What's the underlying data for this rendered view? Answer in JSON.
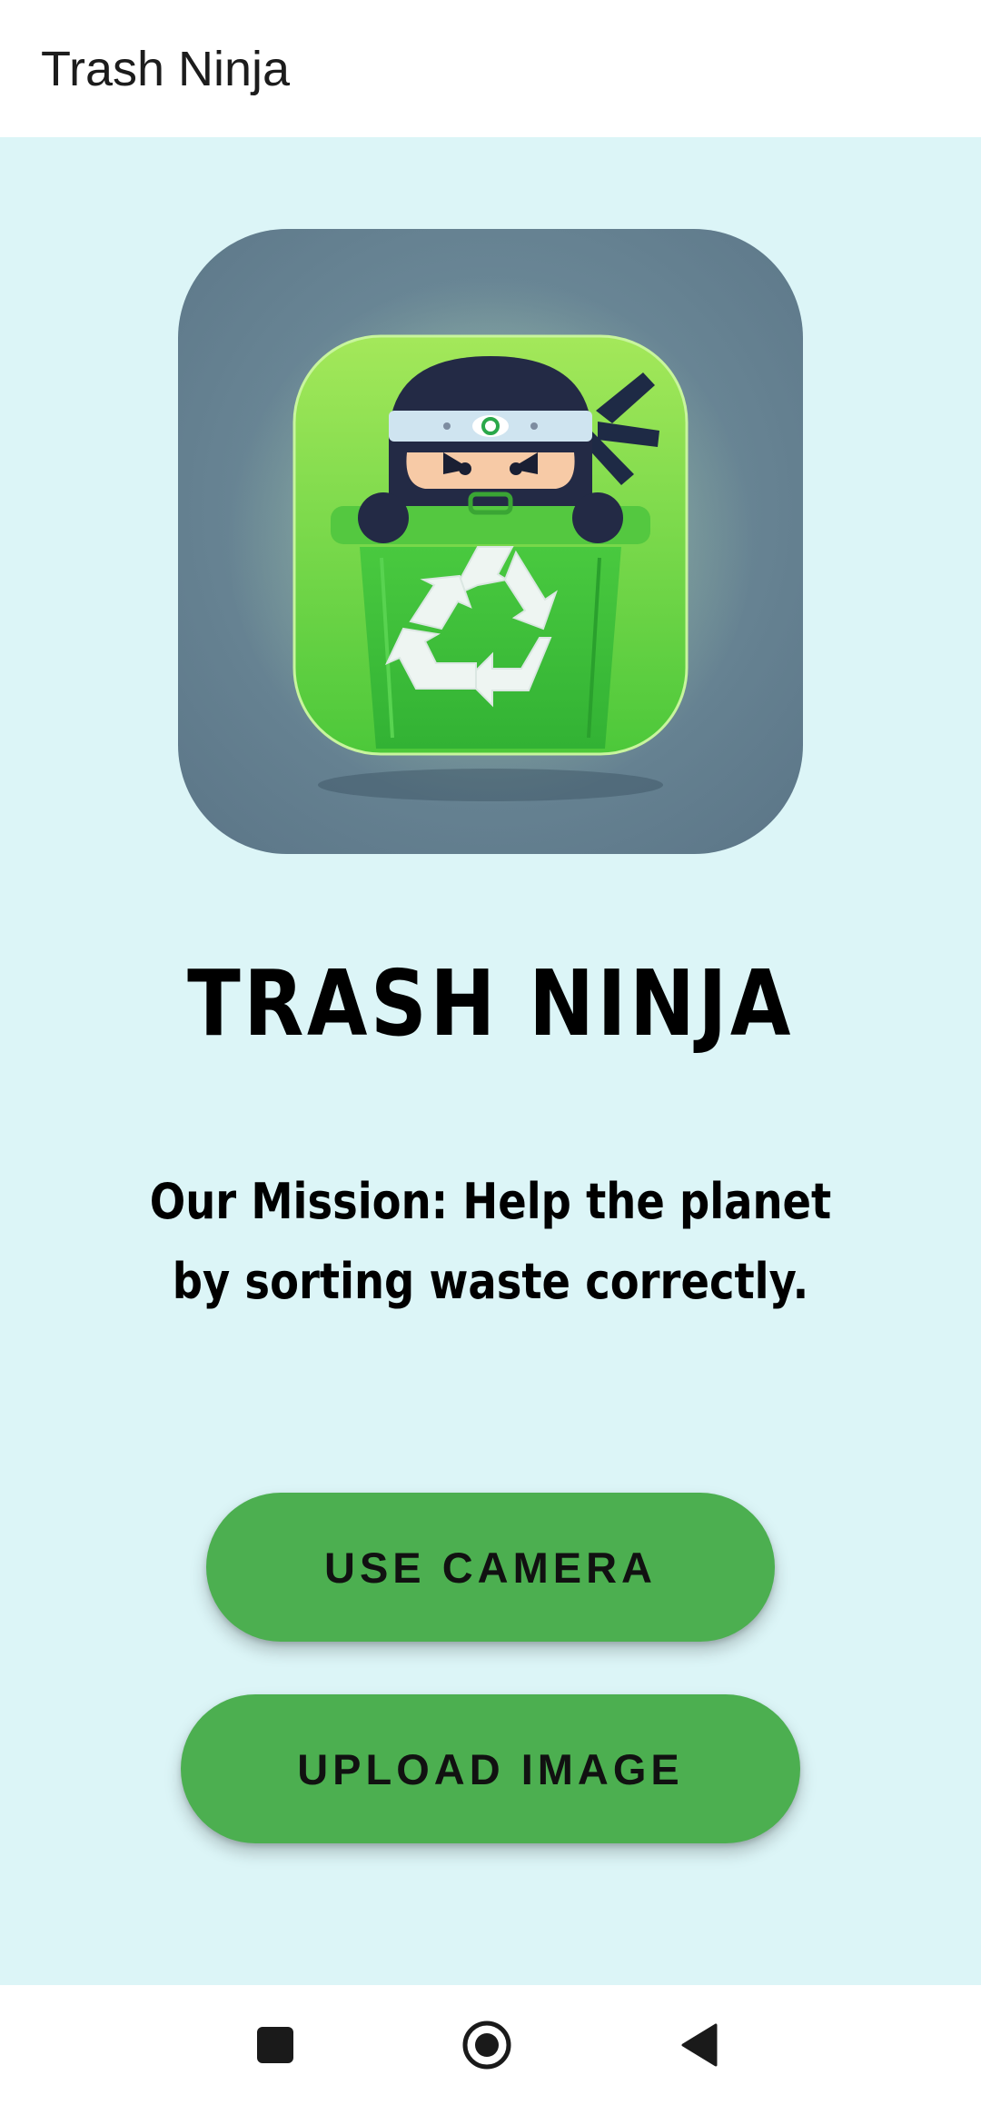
{
  "app_bar": {
    "title": "Trash Ninja"
  },
  "logo": {
    "icon": "ninja-recycling-bin-logo"
  },
  "main": {
    "brand_title": "TRASH NINJA",
    "mission": "Our Mission: Help the planet by sorting waste correctly."
  },
  "buttons": {
    "camera_label": "USE CAMERA",
    "upload_label": "UPLOAD IMAGE"
  },
  "nav_bar": {
    "recents_icon": "square-icon",
    "home_icon": "circle-icon",
    "back_icon": "triangle-back-icon"
  },
  "colors": {
    "background": "#dcf5f7",
    "button": "#4caf50",
    "app_bar": "#ffffff"
  }
}
